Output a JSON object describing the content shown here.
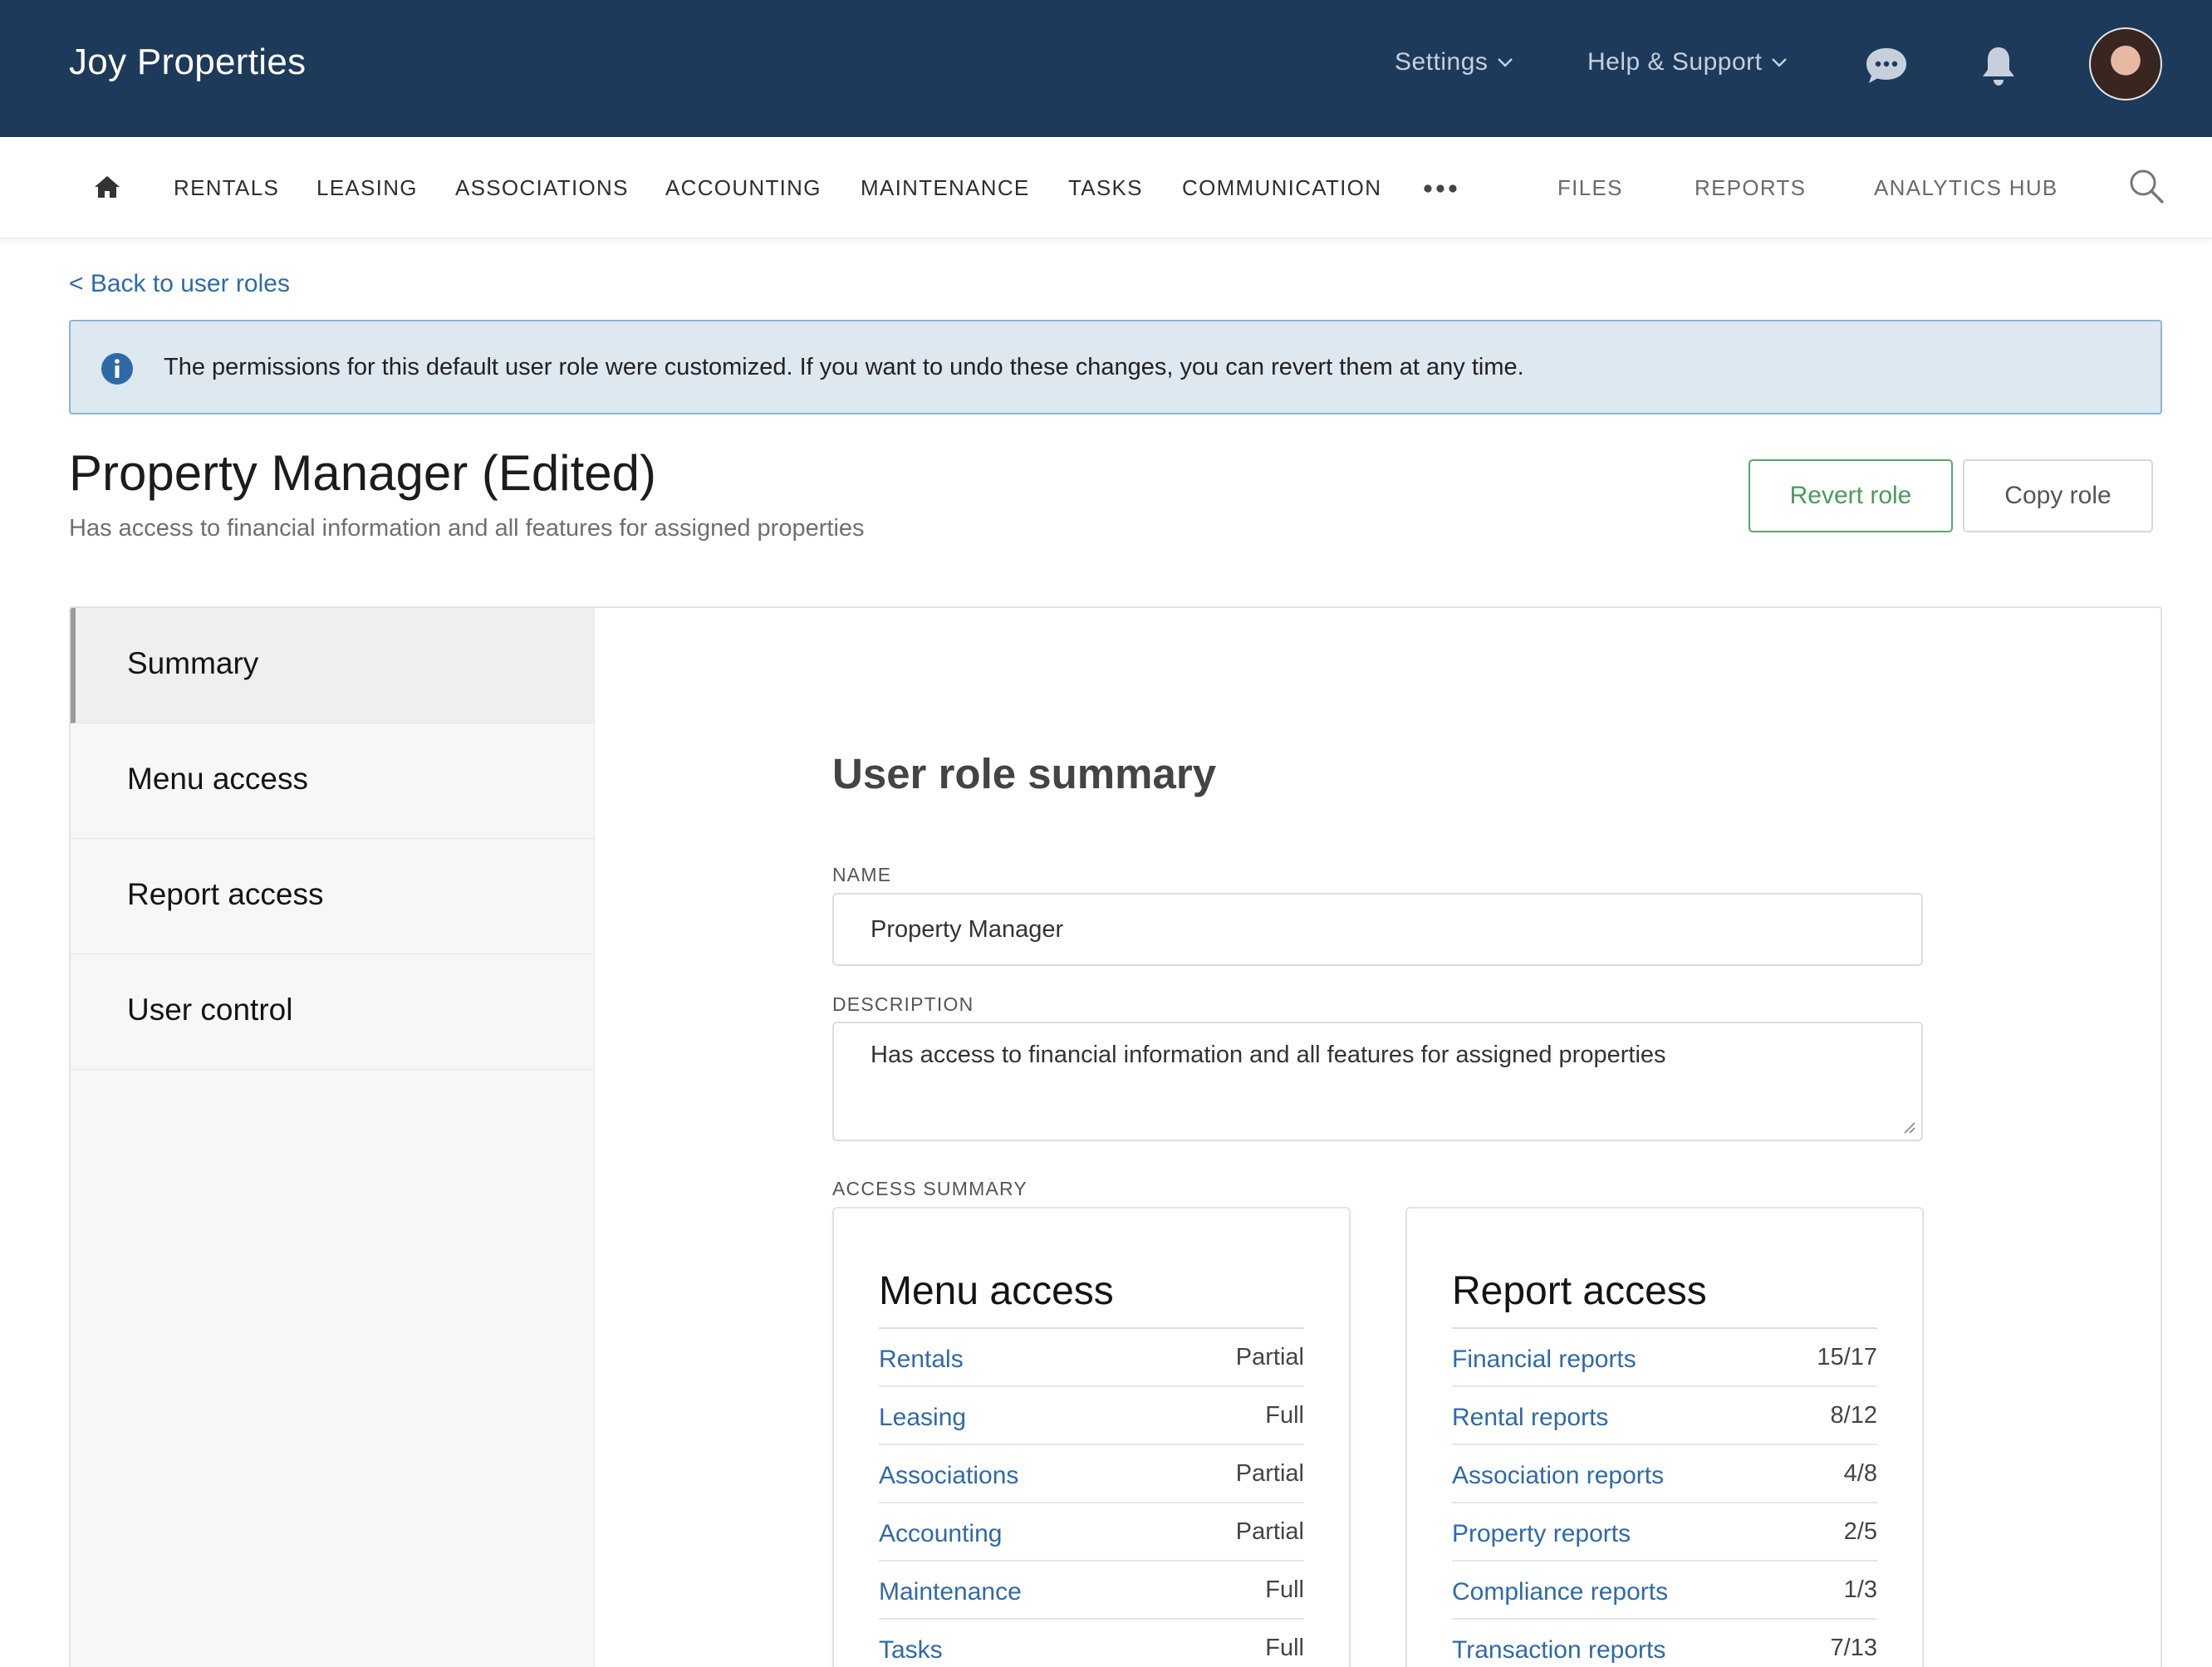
{
  "app": {
    "brand": "Joy Properties",
    "settings_label": "Settings",
    "help_label": "Help & Support"
  },
  "icons": {
    "chat": "chat-bubble-icon",
    "notifications": "bell-icon",
    "home": "home-icon",
    "more": "more-dots-icon",
    "search": "search-icon",
    "info": "info-icon"
  },
  "nav": {
    "rentals": "RENTALS",
    "leasing": "LEASING",
    "associations": "ASSOCIATIONS",
    "accounting": "ACCOUNTING",
    "maintenance": "MAINTENANCE",
    "tasks": "TASKS",
    "communication": "COMMUNICATION",
    "files": "FILES",
    "reports": "REPORTS",
    "analytics": "ANALYTICS HUB"
  },
  "page": {
    "back_link": "< Back to user roles",
    "banner": "The permissions for this default user role were customized. If you want to undo these changes, you can revert them at any time.",
    "title": "Property Manager (Edited)",
    "subtitle": "Has access to financial information and all features for assigned properties",
    "revert_button": "Revert role",
    "copy_button": "Copy role"
  },
  "sidebar": {
    "items": [
      {
        "label": "Summary"
      },
      {
        "label": "Menu access"
      },
      {
        "label": "Report access"
      },
      {
        "label": "User control"
      }
    ]
  },
  "summary": {
    "heading": "User role summary",
    "name_label": "NAME",
    "name_value": "Property Manager",
    "description_label": "DESCRIPTION",
    "description_value": "Has access to financial information and all features for assigned properties",
    "access_label": "ACCESS SUMMARY"
  },
  "menu_access": {
    "title": "Menu access",
    "rows": [
      {
        "label": "Rentals",
        "value": "Partial"
      },
      {
        "label": "Leasing",
        "value": "Full"
      },
      {
        "label": "Associations",
        "value": "Partial"
      },
      {
        "label": "Accounting",
        "value": "Partial"
      },
      {
        "label": "Maintenance",
        "value": "Full"
      },
      {
        "label": "Tasks",
        "value": "Full"
      }
    ]
  },
  "report_access": {
    "title": "Report access",
    "rows": [
      {
        "label": "Financial reports",
        "value": "15/17"
      },
      {
        "label": "Rental reports",
        "value": "8/12"
      },
      {
        "label": "Association reports",
        "value": "4/8"
      },
      {
        "label": "Property reports",
        "value": "2/5"
      },
      {
        "label": "Compliance reports",
        "value": "1/3"
      },
      {
        "label": "Transaction reports",
        "value": "7/13"
      }
    ]
  },
  "colors": {
    "header_bg": "#1e3a5a",
    "link_blue": "#2f6aa8",
    "revert_green": "#4a9a5b",
    "banner_bg": "#dde8f1"
  }
}
